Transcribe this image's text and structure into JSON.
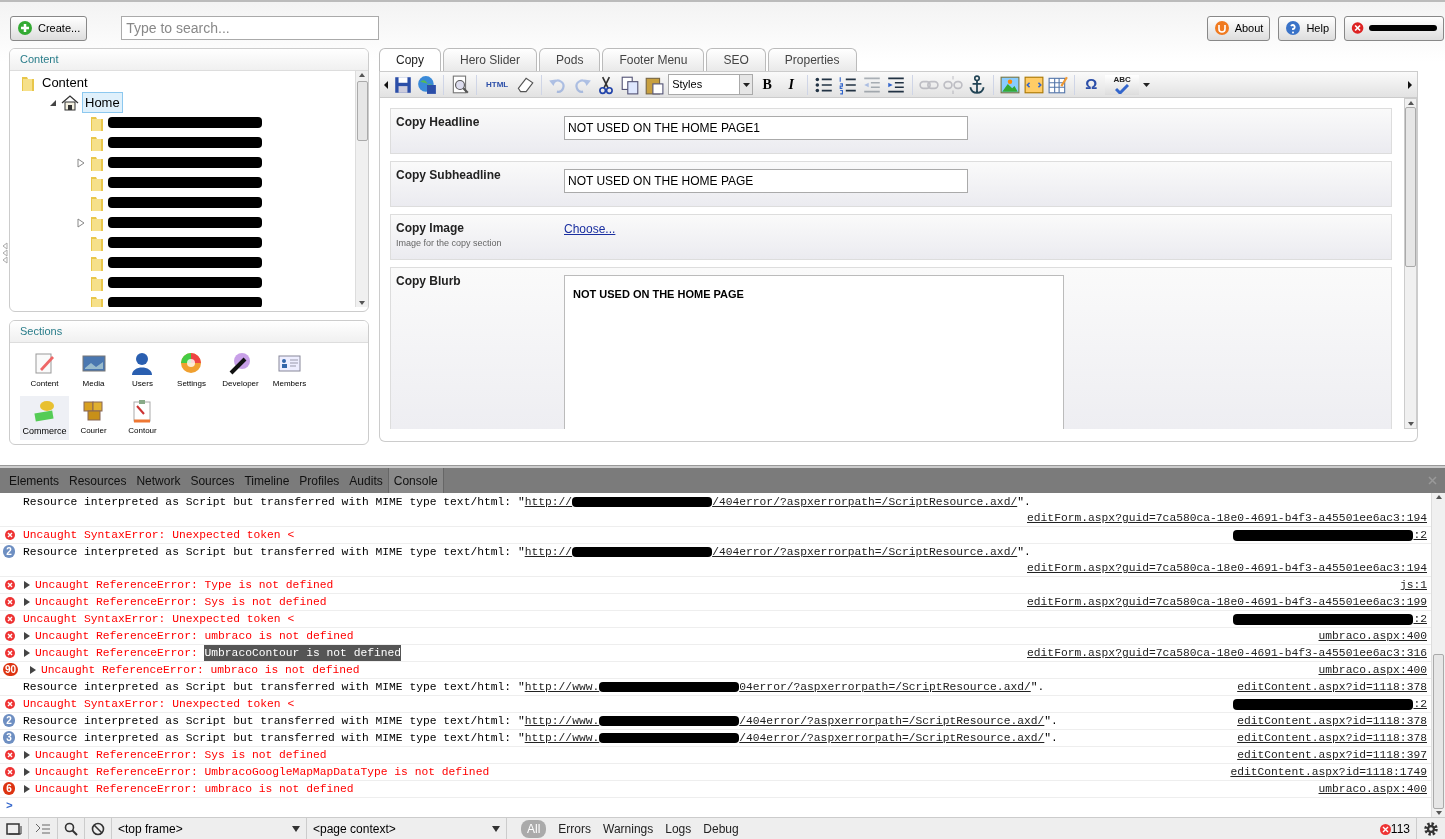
{
  "topbar": {
    "create_button": "Create...",
    "search": {
      "placeholder": "Type to search..."
    },
    "buttons": [
      {
        "kind": "about",
        "label": "About"
      },
      {
        "kind": "help",
        "label": "Help"
      },
      {
        "kind": "logout"
      }
    ]
  },
  "content_panel": {
    "title": "Content",
    "tree": [
      {
        "label": "Content",
        "children": [
          {
            "label": "Home",
            "selected": true,
            "expanded": true,
            "children": [
              {
                "collapsible": false
              },
              {
                "collapsible": false
              },
              {
                "collapsible": true
              },
              {
                "collapsible": false
              },
              {
                "collapsible": false
              },
              {
                "collapsible": true
              },
              {
                "collapsible": false
              },
              {
                "collapsible": false
              },
              {
                "collapsible": false
              },
              {
                "collapsible": false
              }
            ]
          }
        ]
      }
    ]
  },
  "sections_panel": {
    "title": "Sections",
    "items": [
      {
        "kind": "content",
        "label": "Content",
        "selected": false
      },
      {
        "kind": "media",
        "label": "Media",
        "selected": false
      },
      {
        "kind": "users",
        "label": "Users",
        "selected": false
      },
      {
        "kind": "settings",
        "label": "Settings",
        "selected": false
      },
      {
        "kind": "developer",
        "label": "Developer",
        "selected": false
      },
      {
        "kind": "members",
        "label": "Members",
        "selected": false
      },
      {
        "kind": "commerce",
        "label": "Commerce",
        "selected": true
      },
      {
        "kind": "courier",
        "label": "Courier",
        "selected": false
      },
      {
        "kind": "contour",
        "label": "Contour",
        "selected": false
      }
    ]
  },
  "editor": {
    "tabs": [
      {
        "label": "Copy",
        "selected": true
      },
      {
        "label": "Hero Slider",
        "selected": false
      },
      {
        "label": "Pods",
        "selected": false
      },
      {
        "label": "Footer Menu",
        "selected": false
      },
      {
        "label": "SEO",
        "selected": false
      },
      {
        "label": "Properties",
        "selected": false
      }
    ],
    "toolbar": [
      {
        "kind": "save",
        "disabled": false
      },
      {
        "kind": "publish",
        "disabled": false
      },
      {
        "kind": "sep"
      },
      {
        "kind": "preview",
        "disabled": false
      },
      {
        "kind": "sep"
      },
      {
        "kind": "html",
        "disabled": false,
        "label": "HTML"
      },
      {
        "kind": "eraser",
        "disabled": false
      },
      {
        "kind": "sep"
      },
      {
        "kind": "undo",
        "disabled": true
      },
      {
        "kind": "redo",
        "disabled": true
      },
      {
        "kind": "cut",
        "disabled": false
      },
      {
        "kind": "copy",
        "disabled": false
      },
      {
        "kind": "paste",
        "disabled": false
      },
      {
        "kind": "select",
        "value": "Styles"
      },
      {
        "kind": "bold",
        "disabled": false,
        "label": "B"
      },
      {
        "kind": "italic",
        "disabled": false,
        "label": "I"
      },
      {
        "kind": "sep"
      },
      {
        "kind": "bullets",
        "disabled": false
      },
      {
        "kind": "numbers",
        "disabled": false
      },
      {
        "kind": "outdent",
        "disabled": true
      },
      {
        "kind": "indent",
        "disabled": false
      },
      {
        "kind": "sep"
      },
      {
        "kind": "link",
        "disabled": true
      },
      {
        "kind": "unlink",
        "disabled": true
      },
      {
        "kind": "anchor",
        "disabled": false
      },
      {
        "kind": "sep"
      },
      {
        "kind": "image",
        "disabled": false
      },
      {
        "kind": "macro",
        "disabled": false
      },
      {
        "kind": "table",
        "disabled": false
      },
      {
        "kind": "sep"
      },
      {
        "kind": "symbol",
        "disabled": false,
        "label": "Ω"
      },
      {
        "kind": "spell",
        "disabled": false,
        "label": "ABC"
      }
    ],
    "fields": [
      {
        "kind": "text",
        "label": "Copy Headline",
        "value": "NOT USED ON THE HOME PAGE1"
      },
      {
        "kind": "text",
        "label": "Copy Subheadline",
        "value": "NOT USED ON THE HOME PAGE"
      },
      {
        "kind": "media",
        "label": "Copy Image",
        "description": "Image for the copy section",
        "link": "Choose..."
      },
      {
        "kind": "richtext",
        "label": "Copy Blurb",
        "value": "NOT USED ON THE HOME PAGE"
      }
    ]
  },
  "devtools": {
    "tabs": [
      {
        "label": "Elements",
        "selected": false
      },
      {
        "label": "Resources",
        "selected": false
      },
      {
        "label": "Network",
        "selected": false
      },
      {
        "label": "Sources",
        "selected": false
      },
      {
        "label": "Timeline",
        "selected": false
      },
      {
        "label": "Profiles",
        "selected": false
      },
      {
        "label": "Audits",
        "selected": false
      },
      {
        "label": "Console",
        "selected": true
      }
    ],
    "console": [
      {
        "kind": "log",
        "expandable": false,
        "parts": [
          {
            "kind": "plain",
            "text": "Resource interpreted as Script but transferred with MIME type text/html: \""
          },
          {
            "kind": "link",
            "text": "http://"
          },
          {
            "kind": "redacted"
          },
          {
            "kind": "link",
            "text": "/404error/?aspxerrorpath=/ScriptResource.axd/"
          },
          {
            "kind": "plain",
            "text": "\"."
          }
        ],
        "source": "editForm.aspx?guid=7ca580ca-18e0-4691-b4f3-a45501ee6ac3:194",
        "source_redacted": false
      },
      {
        "kind": "error",
        "expandable": false,
        "parts": [
          {
            "kind": "plain",
            "text": "Uncaught SyntaxError: Unexpected token <"
          }
        ],
        "source": ":2",
        "source_redacted": true
      },
      {
        "kind": "log",
        "count": "2",
        "expandable": false,
        "parts": [
          {
            "kind": "plain",
            "text": "Resource interpreted as Script but transferred with MIME type text/html: \""
          },
          {
            "kind": "link",
            "text": "http://"
          },
          {
            "kind": "redacted"
          },
          {
            "kind": "link",
            "text": "/404error/?aspxerrorpath=/ScriptResource.axd/"
          },
          {
            "kind": "plain",
            "text": "\"."
          }
        ],
        "source": "editForm.aspx?guid=7ca580ca-18e0-4691-b4f3-a45501ee6ac3:194",
        "source_redacted": false
      },
      {
        "kind": "error",
        "expandable": true,
        "parts": [
          {
            "kind": "plain",
            "text": "Uncaught ReferenceError: Type is not defined"
          }
        ],
        "source": "js:1",
        "source_redacted": false
      },
      {
        "kind": "error",
        "expandable": true,
        "parts": [
          {
            "kind": "plain",
            "text": "Uncaught ReferenceError: Sys is not defined"
          }
        ],
        "source": "editForm.aspx?guid=7ca580ca-18e0-4691-b4f3-a45501ee6ac3:199",
        "source_redacted": false
      },
      {
        "kind": "error",
        "expandable": false,
        "parts": [
          {
            "kind": "plain",
            "text": "Uncaught SyntaxError: Unexpected token <"
          }
        ],
        "source": ":2",
        "source_redacted": true
      },
      {
        "kind": "error",
        "expandable": true,
        "parts": [
          {
            "kind": "plain",
            "text": "Uncaught ReferenceError: umbraco is not defined"
          }
        ],
        "source": "umbraco.aspx:400",
        "source_redacted": false
      },
      {
        "kind": "error",
        "expandable": true,
        "parts": [
          {
            "kind": "plain",
            "text": "Uncaught ReferenceError: "
          },
          {
            "kind": "selected",
            "text": "UmbracoContour is not defined"
          }
        ],
        "source": "editForm.aspx?guid=7ca580ca-18e0-4691-b4f3-a45501ee6ac3:316",
        "source_redacted": false
      },
      {
        "kind": "error",
        "count": "90",
        "expandable": true,
        "parts": [
          {
            "kind": "plain",
            "text": "Uncaught ReferenceError: umbraco is not defined"
          }
        ],
        "source": "umbraco.aspx:400",
        "source_redacted": false
      },
      {
        "kind": "log",
        "expandable": false,
        "parts": [
          {
            "kind": "plain",
            "text": "Resource interpreted as Script but transferred with MIME type text/html: \""
          },
          {
            "kind": "link",
            "text": "http://www."
          },
          {
            "kind": "redacted"
          },
          {
            "kind": "link",
            "text": "04error/?aspxerrorpath=/ScriptResource.axd/"
          },
          {
            "kind": "plain",
            "text": "\"."
          }
        ],
        "source": "editContent.aspx?id=1118:378",
        "source_redacted": false
      },
      {
        "kind": "error",
        "expandable": false,
        "parts": [
          {
            "kind": "plain",
            "text": "Uncaught SyntaxError: Unexpected token <"
          }
        ],
        "source": ":2",
        "source_redacted": true
      },
      {
        "kind": "log",
        "count": "2",
        "expandable": false,
        "parts": [
          {
            "kind": "plain",
            "text": "Resource interpreted as Script but transferred with MIME type text/html: \""
          },
          {
            "kind": "link",
            "text": "http://www."
          },
          {
            "kind": "redacted"
          },
          {
            "kind": "link",
            "text": "/404error/?aspxerrorpath=/ScriptResource.axd/"
          },
          {
            "kind": "plain",
            "text": "\"."
          }
        ],
        "source": "editContent.aspx?id=1118:378",
        "source_redacted": false
      },
      {
        "kind": "log",
        "count": "3",
        "expandable": false,
        "parts": [
          {
            "kind": "plain",
            "text": "Resource interpreted as Script but transferred with MIME type text/html: \""
          },
          {
            "kind": "link",
            "text": "http://www."
          },
          {
            "kind": "redacted"
          },
          {
            "kind": "link",
            "text": "/404error/?aspxerrorpath=/ScriptResource.axd/"
          },
          {
            "kind": "plain",
            "text": "\"."
          }
        ],
        "source": "editContent.aspx?id=1118:378",
        "source_redacted": false
      },
      {
        "kind": "error",
        "expandable": true,
        "parts": [
          {
            "kind": "plain",
            "text": "Uncaught ReferenceError: Sys is not defined"
          }
        ],
        "source": "editContent.aspx?id=1118:397",
        "source_redacted": false
      },
      {
        "kind": "error",
        "expandable": true,
        "parts": [
          {
            "kind": "plain",
            "text": "Uncaught ReferenceError: UmbracoGoogleMapMapDataType is not defined"
          }
        ],
        "source": "editContent.aspx?id=1118:1749",
        "source_redacted": false
      },
      {
        "kind": "error",
        "count": "6",
        "expandable": true,
        "parts": [
          {
            "kind": "plain",
            "text": "Uncaught ReferenceError: umbraco is not defined"
          }
        ],
        "source": "umbraco.aspx:400",
        "source_redacted": false
      }
    ],
    "prompt": ">",
    "bottom_bar": {
      "frame_select": "<top frame>",
      "context_select": "<page context>",
      "filters": [
        {
          "label": "All",
          "selected": true
        },
        {
          "label": "Errors",
          "selected": false
        },
        {
          "label": "Warnings",
          "selected": false
        },
        {
          "label": "Logs",
          "selected": false
        },
        {
          "label": "Debug",
          "selected": false
        }
      ],
      "error_count": "113"
    }
  }
}
